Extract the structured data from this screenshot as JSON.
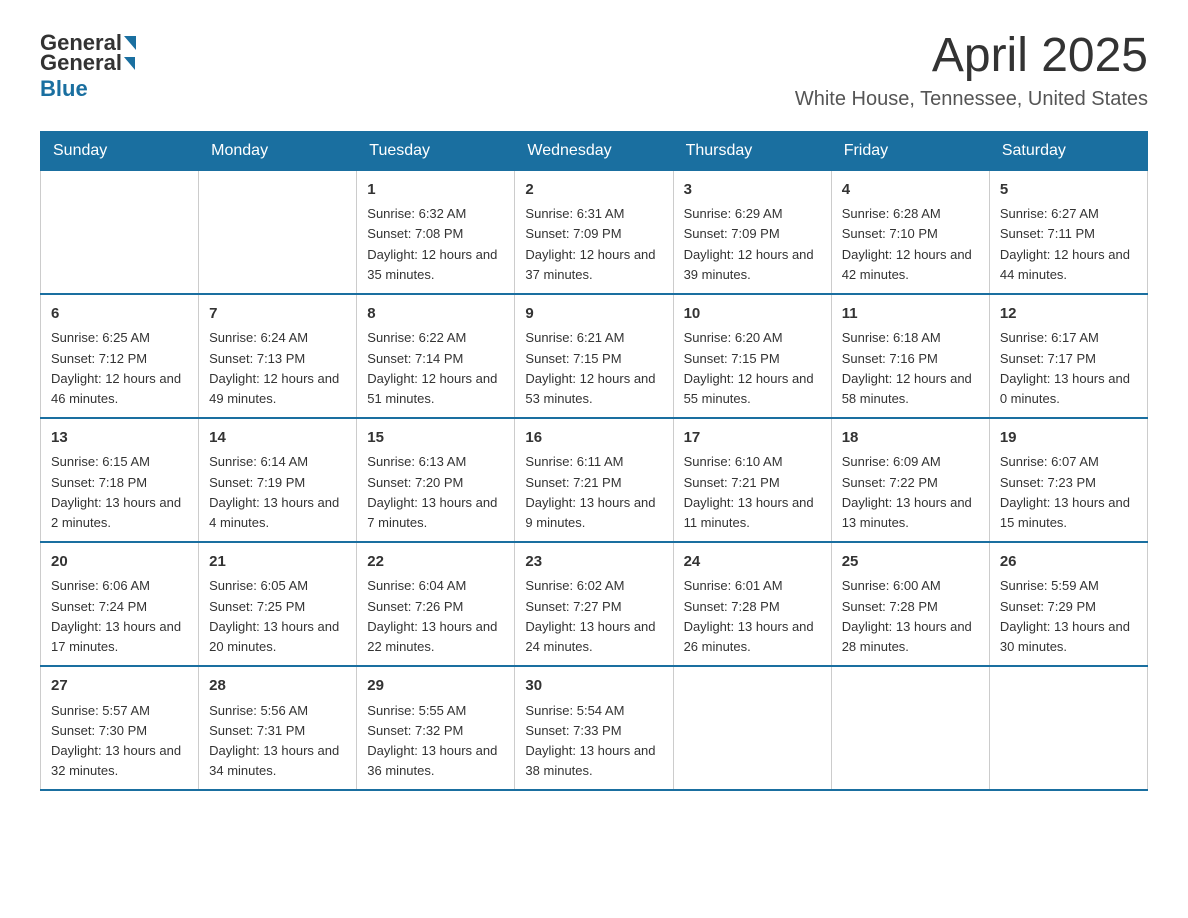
{
  "header": {
    "logo_general": "General",
    "logo_blue": "Blue",
    "month_title": "April 2025",
    "location": "White House, Tennessee, United States"
  },
  "weekdays": [
    "Sunday",
    "Monday",
    "Tuesday",
    "Wednesday",
    "Thursday",
    "Friday",
    "Saturday"
  ],
  "weeks": [
    [
      {
        "day": "",
        "sunrise": "",
        "sunset": "",
        "daylight": ""
      },
      {
        "day": "",
        "sunrise": "",
        "sunset": "",
        "daylight": ""
      },
      {
        "day": "1",
        "sunrise": "Sunrise: 6:32 AM",
        "sunset": "Sunset: 7:08 PM",
        "daylight": "Daylight: 12 hours and 35 minutes."
      },
      {
        "day": "2",
        "sunrise": "Sunrise: 6:31 AM",
        "sunset": "Sunset: 7:09 PM",
        "daylight": "Daylight: 12 hours and 37 minutes."
      },
      {
        "day": "3",
        "sunrise": "Sunrise: 6:29 AM",
        "sunset": "Sunset: 7:09 PM",
        "daylight": "Daylight: 12 hours and 39 minutes."
      },
      {
        "day": "4",
        "sunrise": "Sunrise: 6:28 AM",
        "sunset": "Sunset: 7:10 PM",
        "daylight": "Daylight: 12 hours and 42 minutes."
      },
      {
        "day": "5",
        "sunrise": "Sunrise: 6:27 AM",
        "sunset": "Sunset: 7:11 PM",
        "daylight": "Daylight: 12 hours and 44 minutes."
      }
    ],
    [
      {
        "day": "6",
        "sunrise": "Sunrise: 6:25 AM",
        "sunset": "Sunset: 7:12 PM",
        "daylight": "Daylight: 12 hours and 46 minutes."
      },
      {
        "day": "7",
        "sunrise": "Sunrise: 6:24 AM",
        "sunset": "Sunset: 7:13 PM",
        "daylight": "Daylight: 12 hours and 49 minutes."
      },
      {
        "day": "8",
        "sunrise": "Sunrise: 6:22 AM",
        "sunset": "Sunset: 7:14 PM",
        "daylight": "Daylight: 12 hours and 51 minutes."
      },
      {
        "day": "9",
        "sunrise": "Sunrise: 6:21 AM",
        "sunset": "Sunset: 7:15 PM",
        "daylight": "Daylight: 12 hours and 53 minutes."
      },
      {
        "day": "10",
        "sunrise": "Sunrise: 6:20 AM",
        "sunset": "Sunset: 7:15 PM",
        "daylight": "Daylight: 12 hours and 55 minutes."
      },
      {
        "day": "11",
        "sunrise": "Sunrise: 6:18 AM",
        "sunset": "Sunset: 7:16 PM",
        "daylight": "Daylight: 12 hours and 58 minutes."
      },
      {
        "day": "12",
        "sunrise": "Sunrise: 6:17 AM",
        "sunset": "Sunset: 7:17 PM",
        "daylight": "Daylight: 13 hours and 0 minutes."
      }
    ],
    [
      {
        "day": "13",
        "sunrise": "Sunrise: 6:15 AM",
        "sunset": "Sunset: 7:18 PM",
        "daylight": "Daylight: 13 hours and 2 minutes."
      },
      {
        "day": "14",
        "sunrise": "Sunrise: 6:14 AM",
        "sunset": "Sunset: 7:19 PM",
        "daylight": "Daylight: 13 hours and 4 minutes."
      },
      {
        "day": "15",
        "sunrise": "Sunrise: 6:13 AM",
        "sunset": "Sunset: 7:20 PM",
        "daylight": "Daylight: 13 hours and 7 minutes."
      },
      {
        "day": "16",
        "sunrise": "Sunrise: 6:11 AM",
        "sunset": "Sunset: 7:21 PM",
        "daylight": "Daylight: 13 hours and 9 minutes."
      },
      {
        "day": "17",
        "sunrise": "Sunrise: 6:10 AM",
        "sunset": "Sunset: 7:21 PM",
        "daylight": "Daylight: 13 hours and 11 minutes."
      },
      {
        "day": "18",
        "sunrise": "Sunrise: 6:09 AM",
        "sunset": "Sunset: 7:22 PM",
        "daylight": "Daylight: 13 hours and 13 minutes."
      },
      {
        "day": "19",
        "sunrise": "Sunrise: 6:07 AM",
        "sunset": "Sunset: 7:23 PM",
        "daylight": "Daylight: 13 hours and 15 minutes."
      }
    ],
    [
      {
        "day": "20",
        "sunrise": "Sunrise: 6:06 AM",
        "sunset": "Sunset: 7:24 PM",
        "daylight": "Daylight: 13 hours and 17 minutes."
      },
      {
        "day": "21",
        "sunrise": "Sunrise: 6:05 AM",
        "sunset": "Sunset: 7:25 PM",
        "daylight": "Daylight: 13 hours and 20 minutes."
      },
      {
        "day": "22",
        "sunrise": "Sunrise: 6:04 AM",
        "sunset": "Sunset: 7:26 PM",
        "daylight": "Daylight: 13 hours and 22 minutes."
      },
      {
        "day": "23",
        "sunrise": "Sunrise: 6:02 AM",
        "sunset": "Sunset: 7:27 PM",
        "daylight": "Daylight: 13 hours and 24 minutes."
      },
      {
        "day": "24",
        "sunrise": "Sunrise: 6:01 AM",
        "sunset": "Sunset: 7:28 PM",
        "daylight": "Daylight: 13 hours and 26 minutes."
      },
      {
        "day": "25",
        "sunrise": "Sunrise: 6:00 AM",
        "sunset": "Sunset: 7:28 PM",
        "daylight": "Daylight: 13 hours and 28 minutes."
      },
      {
        "day": "26",
        "sunrise": "Sunrise: 5:59 AM",
        "sunset": "Sunset: 7:29 PM",
        "daylight": "Daylight: 13 hours and 30 minutes."
      }
    ],
    [
      {
        "day": "27",
        "sunrise": "Sunrise: 5:57 AM",
        "sunset": "Sunset: 7:30 PM",
        "daylight": "Daylight: 13 hours and 32 minutes."
      },
      {
        "day": "28",
        "sunrise": "Sunrise: 5:56 AM",
        "sunset": "Sunset: 7:31 PM",
        "daylight": "Daylight: 13 hours and 34 minutes."
      },
      {
        "day": "29",
        "sunrise": "Sunrise: 5:55 AM",
        "sunset": "Sunset: 7:32 PM",
        "daylight": "Daylight: 13 hours and 36 minutes."
      },
      {
        "day": "30",
        "sunrise": "Sunrise: 5:54 AM",
        "sunset": "Sunset: 7:33 PM",
        "daylight": "Daylight: 13 hours and 38 minutes."
      },
      {
        "day": "",
        "sunrise": "",
        "sunset": "",
        "daylight": ""
      },
      {
        "day": "",
        "sunrise": "",
        "sunset": "",
        "daylight": ""
      },
      {
        "day": "",
        "sunrise": "",
        "sunset": "",
        "daylight": ""
      }
    ]
  ]
}
